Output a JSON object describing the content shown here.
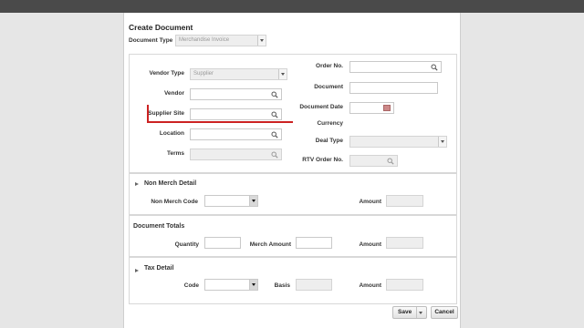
{
  "page": {
    "title": "Create Document",
    "document_type_label": "Document Type",
    "document_type_value": "Merchandise Invoice"
  },
  "header_form": {
    "vendor_type_label": "Vendor Type",
    "vendor_type_value": "Supplier",
    "vendor_label": "Vendor",
    "supplier_site_label": "Supplier Site",
    "location_label": "Location",
    "terms_label": "Terms",
    "order_no_label": "Order No.",
    "document_label": "Document",
    "document_date_label": "Document Date",
    "currency_label": "Currency",
    "deal_type_label": "Deal Type",
    "rtv_order_no_label": "RTV Order No."
  },
  "non_merch": {
    "heading": "Non Merch Detail",
    "code_label": "Non Merch Code",
    "amount_label": "Amount"
  },
  "totals": {
    "heading": "Document Totals",
    "quantity_label": "Quantity",
    "merch_amount_label": "Merch Amount",
    "amount_label": "Amount"
  },
  "tax": {
    "heading": "Tax Detail",
    "code_label": "Code",
    "basis_label": "Basis",
    "amount_label": "Amount"
  },
  "actions": {
    "save_label": "Save",
    "cancel_label": "Cancel"
  },
  "colors": {
    "annotation": "#cc2222",
    "field_border": "#c9c9c9",
    "disabled_field": "#eeeeee"
  },
  "icons": {
    "search": "search-icon",
    "calendar": "calendar-icon",
    "dropdown": "chevron-down-icon",
    "collapse": "triangle-icon"
  }
}
